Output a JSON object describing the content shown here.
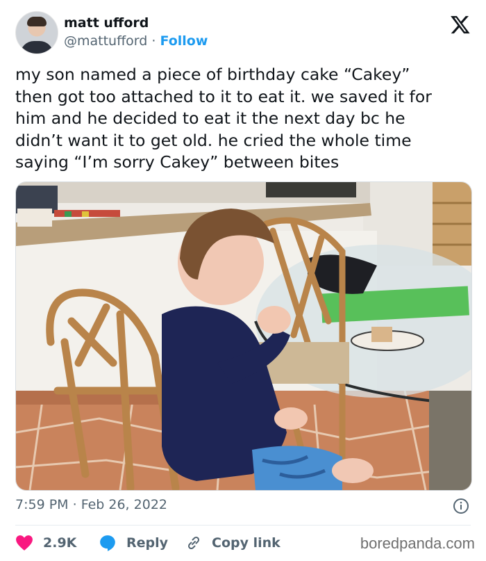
{
  "author": {
    "name": "matt ufford",
    "handle": "@mattufford",
    "separator": "·",
    "follow_label": "Follow"
  },
  "tweet": {
    "text": "my son named a piece of birthday cake “Cakey”\nthen got too attached to it to eat it. we saved it for\nhim and he decided to eat it the next day bc he\ndidn’t want it to get old. he cried the whole time\nsaying “I’m sorry Cakey” between bites"
  },
  "meta": {
    "time": "7:59 PM",
    "separator": "·",
    "date": "Feb 26, 2022"
  },
  "actions": {
    "likes": "2.9K",
    "reply_label": "Reply",
    "copy_label": "Copy link"
  },
  "watermark": "boredpanda.com",
  "icons": {
    "brand": "x-logo-icon",
    "info": "info-icon",
    "like": "heart-icon",
    "reply": "reply-bubble-icon",
    "copy": "link-icon"
  },
  "colors": {
    "accent": "#1d9bf0",
    "like": "#f91880",
    "text": "#0f1419",
    "muted": "#536471"
  }
}
